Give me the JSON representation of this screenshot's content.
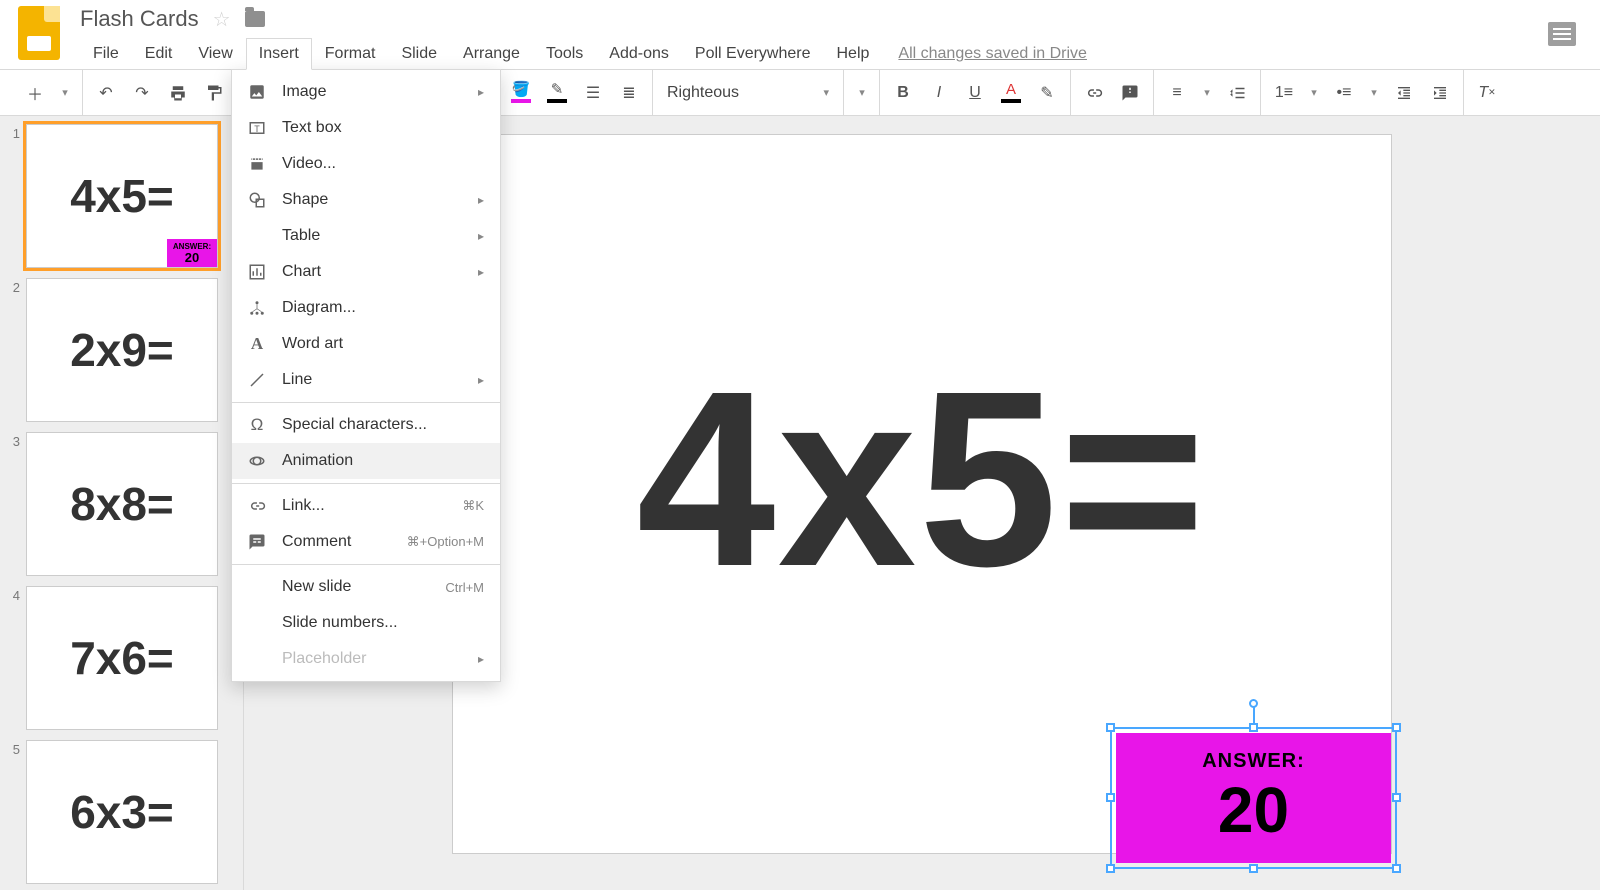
{
  "header": {
    "app_title": "Flash Cards",
    "save_status": "All changes saved in Drive"
  },
  "menus": [
    "File",
    "Edit",
    "View",
    "Insert",
    "Format",
    "Slide",
    "Arrange",
    "Tools",
    "Add-ons",
    "Poll Everywhere",
    "Help"
  ],
  "open_menu_index": 3,
  "toolbar": {
    "font_name": "Righteous",
    "fill_color": "#e815e8",
    "border_color": "#000000",
    "text_color": "#000000"
  },
  "insert_menu": [
    {
      "icon": "image",
      "label": "Image",
      "submenu": true
    },
    {
      "icon": "textbox",
      "label": "Text box"
    },
    {
      "icon": "video",
      "label": "Video..."
    },
    {
      "icon": "shape",
      "label": "Shape",
      "submenu": true
    },
    {
      "icon": "",
      "label": "Table",
      "submenu": true
    },
    {
      "icon": "chart",
      "label": "Chart",
      "submenu": true
    },
    {
      "icon": "diagram",
      "label": "Diagram..."
    },
    {
      "icon": "wordart",
      "label": "Word art"
    },
    {
      "icon": "line",
      "label": "Line",
      "submenu": true
    },
    {
      "sep": true
    },
    {
      "icon": "omega",
      "label": "Special characters..."
    },
    {
      "icon": "anim",
      "label": "Animation",
      "hovered": true
    },
    {
      "sep": true
    },
    {
      "icon": "link",
      "label": "Link...",
      "shortcut": "⌘K"
    },
    {
      "icon": "comment",
      "label": "Comment",
      "shortcut": "⌘+Option+M"
    },
    {
      "sep": true
    },
    {
      "icon": "",
      "label": "New slide",
      "shortcut": "Ctrl+M"
    },
    {
      "icon": "",
      "label": "Slide numbers..."
    },
    {
      "icon": "",
      "label": "Placeholder",
      "submenu": true,
      "disabled": true
    }
  ],
  "thumbnails": [
    {
      "num": "1",
      "eq": "4x5=",
      "answer_label": "ANSWER:",
      "answer": "20",
      "active": true
    },
    {
      "num": "2",
      "eq": "2x9="
    },
    {
      "num": "3",
      "eq": "8x8="
    },
    {
      "num": "4",
      "eq": "7x6="
    },
    {
      "num": "5",
      "eq": "6x3="
    }
  ],
  "slide": {
    "equation": "4x5=",
    "answer_label": "ANSWER:",
    "answer": "20"
  }
}
